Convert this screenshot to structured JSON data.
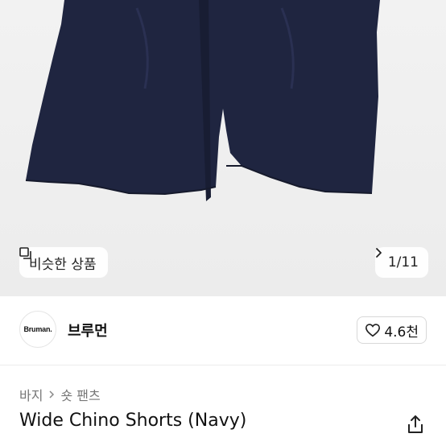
{
  "gallery": {
    "similar_label": "비슷한 상품",
    "similar_icon": "similar-items-icon",
    "counter": "1/11",
    "next_icon": "chevron-right-icon"
  },
  "shop": {
    "logo_text": "Bruman.",
    "name": "브루먼",
    "like_icon": "heart-icon",
    "likes": "4.6천"
  },
  "category": [
    "바지",
    "숏 팬츠"
  ],
  "product": {
    "title": "Wide Chino Shorts (Navy)",
    "share_icon": "share-icon"
  },
  "colors": {
    "product_navy": "#1f2540",
    "accent": "#111111"
  }
}
